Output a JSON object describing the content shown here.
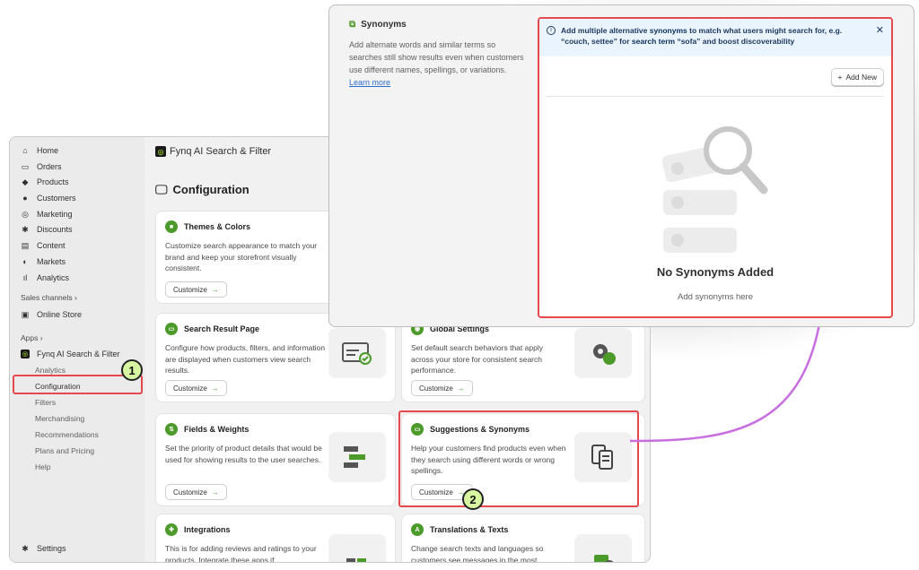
{
  "sidebar": {
    "items": [
      {
        "label": "Home",
        "icon": "home-icon"
      },
      {
        "label": "Orders",
        "icon": "orders-icon"
      },
      {
        "label": "Products",
        "icon": "tag-icon"
      },
      {
        "label": "Customers",
        "icon": "person-icon"
      },
      {
        "label": "Marketing",
        "icon": "target-icon"
      },
      {
        "label": "Discounts",
        "icon": "discount-icon"
      },
      {
        "label": "Content",
        "icon": "content-icon"
      },
      {
        "label": "Markets",
        "icon": "globe-icon"
      },
      {
        "label": "Analytics",
        "icon": "bar-chart-icon"
      }
    ],
    "sales_channels": "Sales channels",
    "online_store": "Online Store",
    "apps": "Apps",
    "app_name": "Fynq AI Search & Filter",
    "sub_items": [
      "Analytics",
      "Configuration",
      "Filters",
      "Merchandising",
      "Recommendations",
      "Plans and Pricing",
      "Help"
    ],
    "settings": "Settings",
    "chevron": "›"
  },
  "badges": {
    "one": "1",
    "two": "2"
  },
  "app_header": {
    "title": "Fynq AI Search & Filter"
  },
  "page": {
    "title": "Configuration"
  },
  "customize_label": "Customize",
  "cards": {
    "themes": {
      "title": "Themes & Colors",
      "desc": "Customize search appearance to match your brand and keep your storefront visually consistent."
    },
    "search_result": {
      "title": "Search Result Page",
      "desc": "Configure how products, filters, and information are displayed when customers view search results."
    },
    "global": {
      "title": "Global Settings",
      "desc": "Set default search behaviors that apply across your store for consistent search performance."
    },
    "fields": {
      "title": "Fields & Weights",
      "desc": "Set the priority of product details that would be used for showing results to the user searches."
    },
    "suggestions": {
      "title": "Suggestions & Synonyms",
      "desc": "Help your customers find products even when they search using different words or wrong spellings."
    },
    "integrations": {
      "title": "Integrations",
      "desc": "This is for adding reviews and ratings to your products. Integrate these apps if"
    },
    "translations": {
      "title": "Translations & Texts",
      "desc": "Change search texts and languages so customers see messages in the most"
    }
  },
  "synonyms": {
    "title": "Synonyms",
    "desc": "Add alternate words and similar terms so searches still show results even when customers use different names, spellings, or variations.",
    "learn_more": "Learn more",
    "banner_1": "Add multiple alternative ",
    "banner_2": "synonyms",
    "banner_3": " to match what users might search for, e.g. “couch, settee” for ",
    "banner_4": "search term",
    "banner_5": " “sofa” and boost discoverability",
    "add_new": "Add New",
    "empty_title": "No Synonyms Added",
    "empty_sub": "Add synonyms here"
  },
  "colors": {
    "accent_red": "#e5484d",
    "arrow_purple": "#c86ee0",
    "badge_green": "#d8f5a2",
    "brand_green": "#4c9a2a"
  }
}
